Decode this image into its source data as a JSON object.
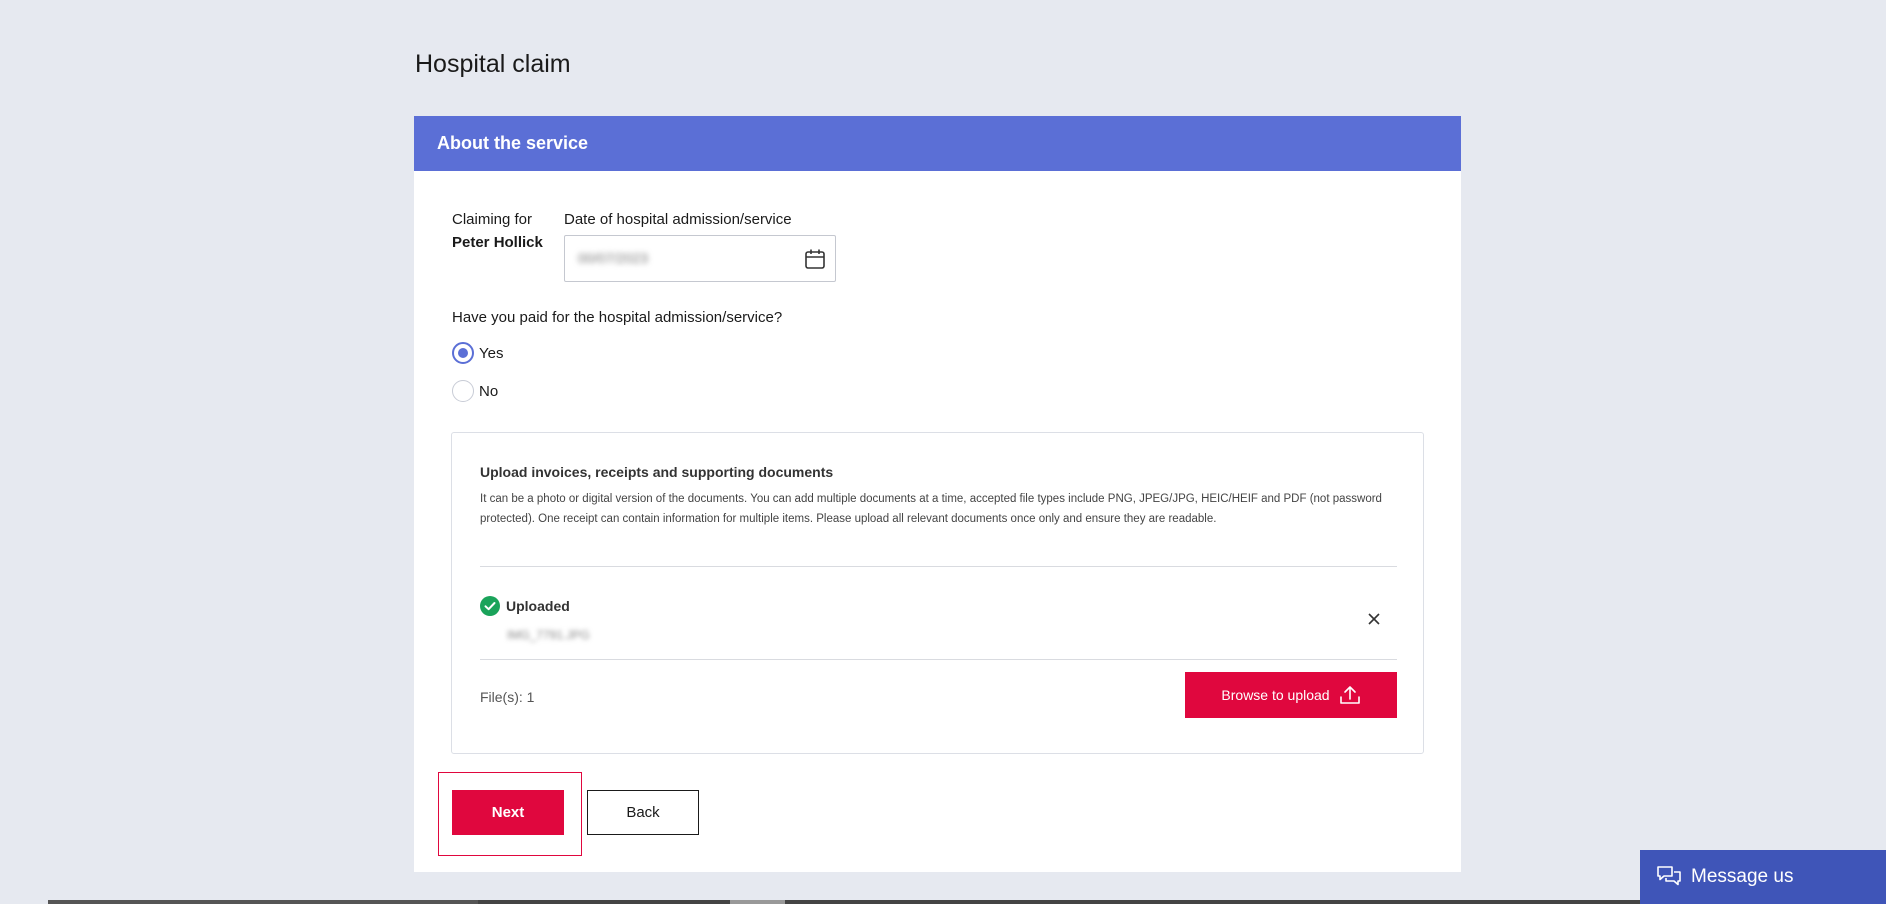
{
  "page": {
    "title": "Hospital claim"
  },
  "section": {
    "header": "About the service"
  },
  "claim": {
    "claiming_for_label": "Claiming for",
    "claimant_name": "Peter Hollick",
    "date_label": "Date of hospital admission/service",
    "date_value": "00/07/2023"
  },
  "paid": {
    "question": "Have you paid for the hospital admission/service?",
    "options": [
      {
        "label": "Yes",
        "checked": true
      },
      {
        "label": "No",
        "checked": false
      }
    ]
  },
  "upload": {
    "title": "Upload invoices, receipts and supporting documents",
    "description": "It can be a photo or digital version of the documents. You can add multiple documents at a time, accepted file types include PNG, JPEG/JPG, HEIC/HEIF and PDF (not password protected). One receipt can contain information for multiple items. Please upload all relevant documents once only and ensure they are readable.",
    "status": "Uploaded",
    "file_name": "IMG_7791.JPG",
    "files_count": "File(s): 1",
    "browse_label": "Browse to upload"
  },
  "actions": {
    "next_label": "Next",
    "back_label": "Back"
  },
  "chat": {
    "label": "Message us"
  },
  "colors": {
    "accent": "#5b6fd6",
    "primary_button": "#e0073e",
    "success": "#1aa35a",
    "chat": "#3f55b8"
  }
}
